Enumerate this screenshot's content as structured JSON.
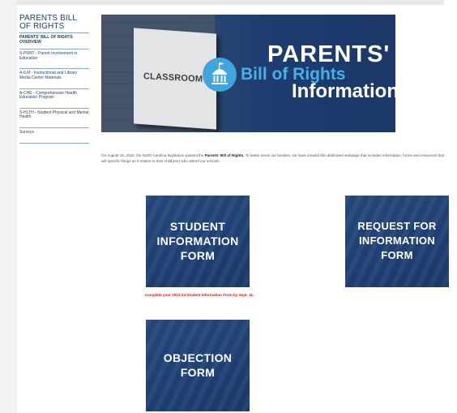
{
  "sidebar": {
    "title": "PARENTS BILL OF RIGHTS",
    "items": [
      {
        "label": "PARENTS' BILL OF RIGHTS OVERVIEW"
      },
      {
        "label": "S-PRNT - Parent Involvement in Education"
      },
      {
        "label": "A-ILM - Instructional and Library Media Center Materials"
      },
      {
        "label": "A-CHE - Comprehensive Health Education Program"
      },
      {
        "label": "S-HLTH - Student Physical and Mental Health"
      },
      {
        "label": "Surveys"
      }
    ]
  },
  "hero": {
    "sign_text": "CLASSROOM",
    "line1": "PARENTS'",
    "line2": "Bill of Rights",
    "line3": "Information",
    "colors": {
      "navy": "#1e3d70",
      "accent": "#45b0ea"
    }
  },
  "intro": {
    "before": "On August 15, 2023, the North Carolina legislature passed the ",
    "bold": "Parents' Bill of Rights.",
    "after": " To better serve our families, we have created this dedicated webpage that includes information, forms and resources that will specific things as it relates to their child(ren) who attend our schools."
  },
  "cards": [
    {
      "label": "STUDENT INFORMATION FORM"
    },
    {
      "label": "REQUEST FOR INFORMATION FORM"
    },
    {
      "label": "OBJECTION FORM"
    }
  ],
  "note": "Complete your 2023-24 Student Information Form by Sept. 11.",
  "colors": {
    "note_red": "#cc1f1f",
    "sidebar_text": "#1d3e66"
  }
}
